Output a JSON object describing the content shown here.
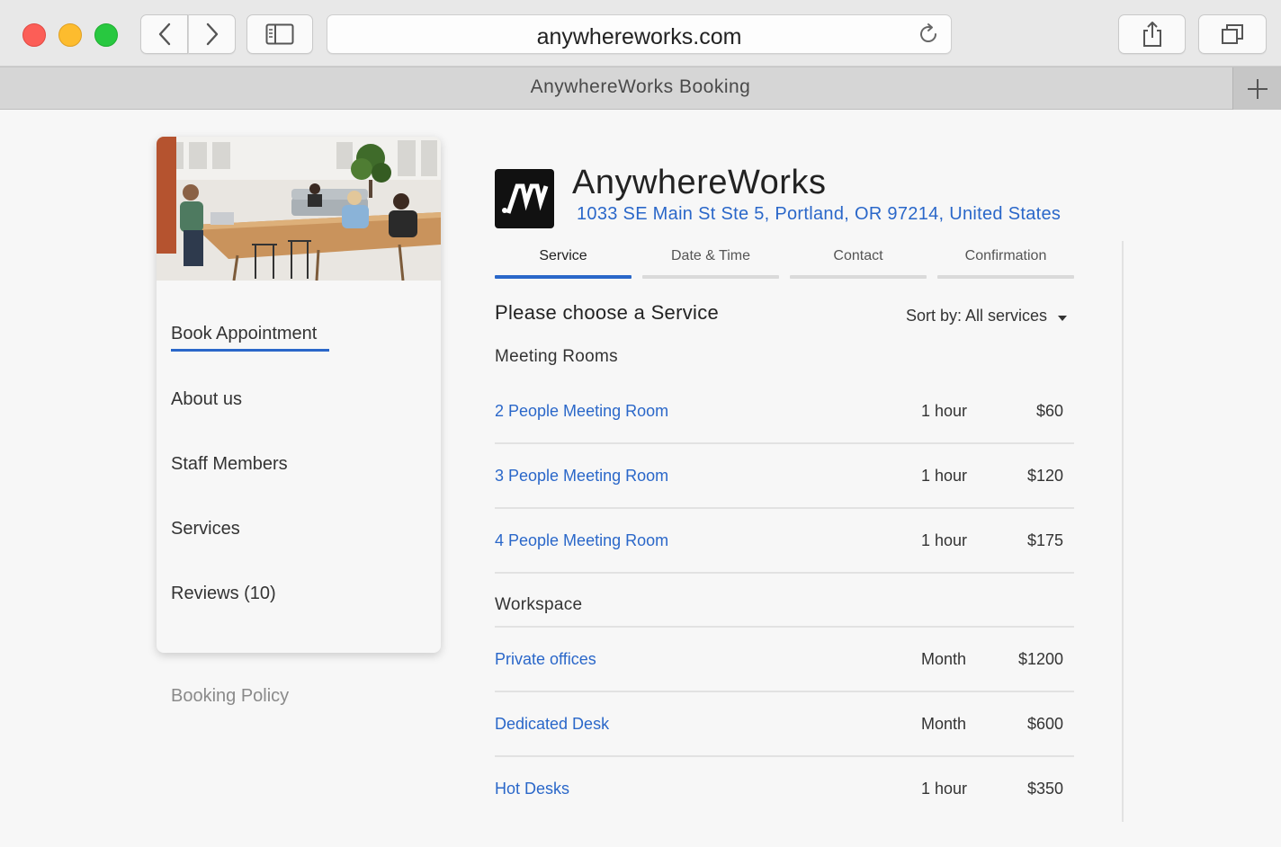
{
  "browser": {
    "url": "anywhereworks.com",
    "tab_title": "AnywhereWorks Booking"
  },
  "sidebar": {
    "items": [
      {
        "label": "Book Appointment",
        "active": true
      },
      {
        "label": "About us"
      },
      {
        "label": "Staff Members"
      },
      {
        "label": "Services"
      },
      {
        "label": "Reviews (10)"
      }
    ],
    "booking_policy": "Booking Policy"
  },
  "business": {
    "name": "AnywhereWorks",
    "address": "1033 SE Main St Ste 5, Portland, OR 97214, United States",
    "logo_text": "AW"
  },
  "steps": [
    {
      "label": "Service",
      "active": true
    },
    {
      "label": "Date & Time"
    },
    {
      "label": "Contact"
    },
    {
      "label": "Confirmation"
    }
  ],
  "main": {
    "title": "Please choose a Service",
    "sort_label": "Sort by: All services"
  },
  "groups": [
    {
      "title": "Meeting Rooms",
      "services": [
        {
          "name": "2 People Meeting Room",
          "duration": "1 hour",
          "price": "$60"
        },
        {
          "name": "3 People Meeting Room",
          "duration": "1 hour",
          "price": "$120"
        },
        {
          "name": "4 People Meeting Room",
          "duration": "1 hour",
          "price": "$175"
        }
      ]
    },
    {
      "title": "Workspace",
      "services": [
        {
          "name": "Private offices",
          "duration": "Month",
          "price": "$1200"
        },
        {
          "name": "Dedicated Desk",
          "duration": "Month",
          "price": "$600"
        },
        {
          "name": "Hot Desks",
          "duration": "1 hour",
          "price": "$350"
        }
      ]
    }
  ],
  "colors": {
    "accent": "#2a67c9",
    "text": "#333333",
    "muted": "#8a8a8a"
  }
}
